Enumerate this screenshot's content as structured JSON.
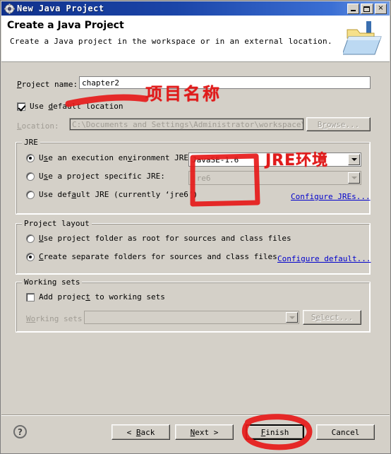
{
  "window": {
    "title": "New Java Project",
    "icon": "java-project-gear-icon",
    "controls": {
      "minimize": "minimize-button",
      "maximize": "maximize-button",
      "close": "×"
    }
  },
  "header": {
    "title": "Create a Java Project",
    "description": "Create a Java project in the workspace or in an external location.",
    "icon": "new-java-project-folder-icon"
  },
  "project_name": {
    "label_prefix": "P",
    "label_rest": "roject name:",
    "value": "chapter2"
  },
  "default_location": {
    "label_a": "Use ",
    "label_mnemonic": "d",
    "label_b": "efault location",
    "checked": true
  },
  "location": {
    "label_prefix": "L",
    "label_rest": "ocation:",
    "value": "C:\\Documents and Settings\\Administrator\\workspace\\chapter",
    "browse_label_a": "B",
    "browse_label_mnemonic": "r",
    "browse_label_b": "owse...",
    "disabled": true
  },
  "jre": {
    "group_title": "JRE",
    "options": [
      {
        "id": "execution-environment",
        "text_a": "U",
        "mnemonic1": "s",
        "text_b": "e an execution en",
        "mnemonic2": "v",
        "text_c": "ironment JRE:",
        "selected": true
      },
      {
        "id": "project-specific",
        "text_a": "U",
        "mnemonic1": "s",
        "text_b": "e a project specific JRE:",
        "selected": false
      },
      {
        "id": "default-jre",
        "text_a": "Use def",
        "mnemonic1": "a",
        "text_b": "ult JRE (currently ‘jre6’)",
        "selected": false
      }
    ],
    "execution_env_value": "JavaSE-1.6",
    "project_jre_value": "jre6",
    "configure_link": "Configure JREs..."
  },
  "project_layout": {
    "group_title": "Project layout",
    "options": [
      {
        "id": "project-folder-root",
        "text_a": "",
        "mnemonic": "U",
        "text_b": "se project folder as root for sources and class files",
        "selected": false
      },
      {
        "id": "separate-folders",
        "text_a": "",
        "mnemonic": "C",
        "text_b": "reate separate folders for sources and class files",
        "selected": true
      }
    ],
    "configure_link": "Configure default..."
  },
  "working_sets": {
    "group_title": "Working sets",
    "checkbox_a": "Add projec",
    "checkbox_mnemonic": "t",
    "checkbox_b": " to working sets",
    "checked": false,
    "label_a": "W",
    "label_mnemonic": "o",
    "label_b": "rking sets:",
    "value": "",
    "select_a": "S",
    "select_mnemonic": "e",
    "select_b": "lect..."
  },
  "buttons": {
    "help": "?",
    "back_prefix": "< ",
    "back_mnemonic": "B",
    "back_rest": "ack",
    "next_prefix": "",
    "next_mnemonic": "N",
    "next_rest": "ext >",
    "finish_mnemonic": "F",
    "finish_rest": "inish",
    "cancel": "Cancel"
  },
  "annotations": {
    "project_name_cn": "项目名称",
    "jre_cn": "JRE环境",
    "color": "#e01b1b",
    "marks": [
      "underline-stroke-under-project-name",
      "rectangle-around-jre-combos",
      "ellipse-around-finish-button"
    ]
  }
}
